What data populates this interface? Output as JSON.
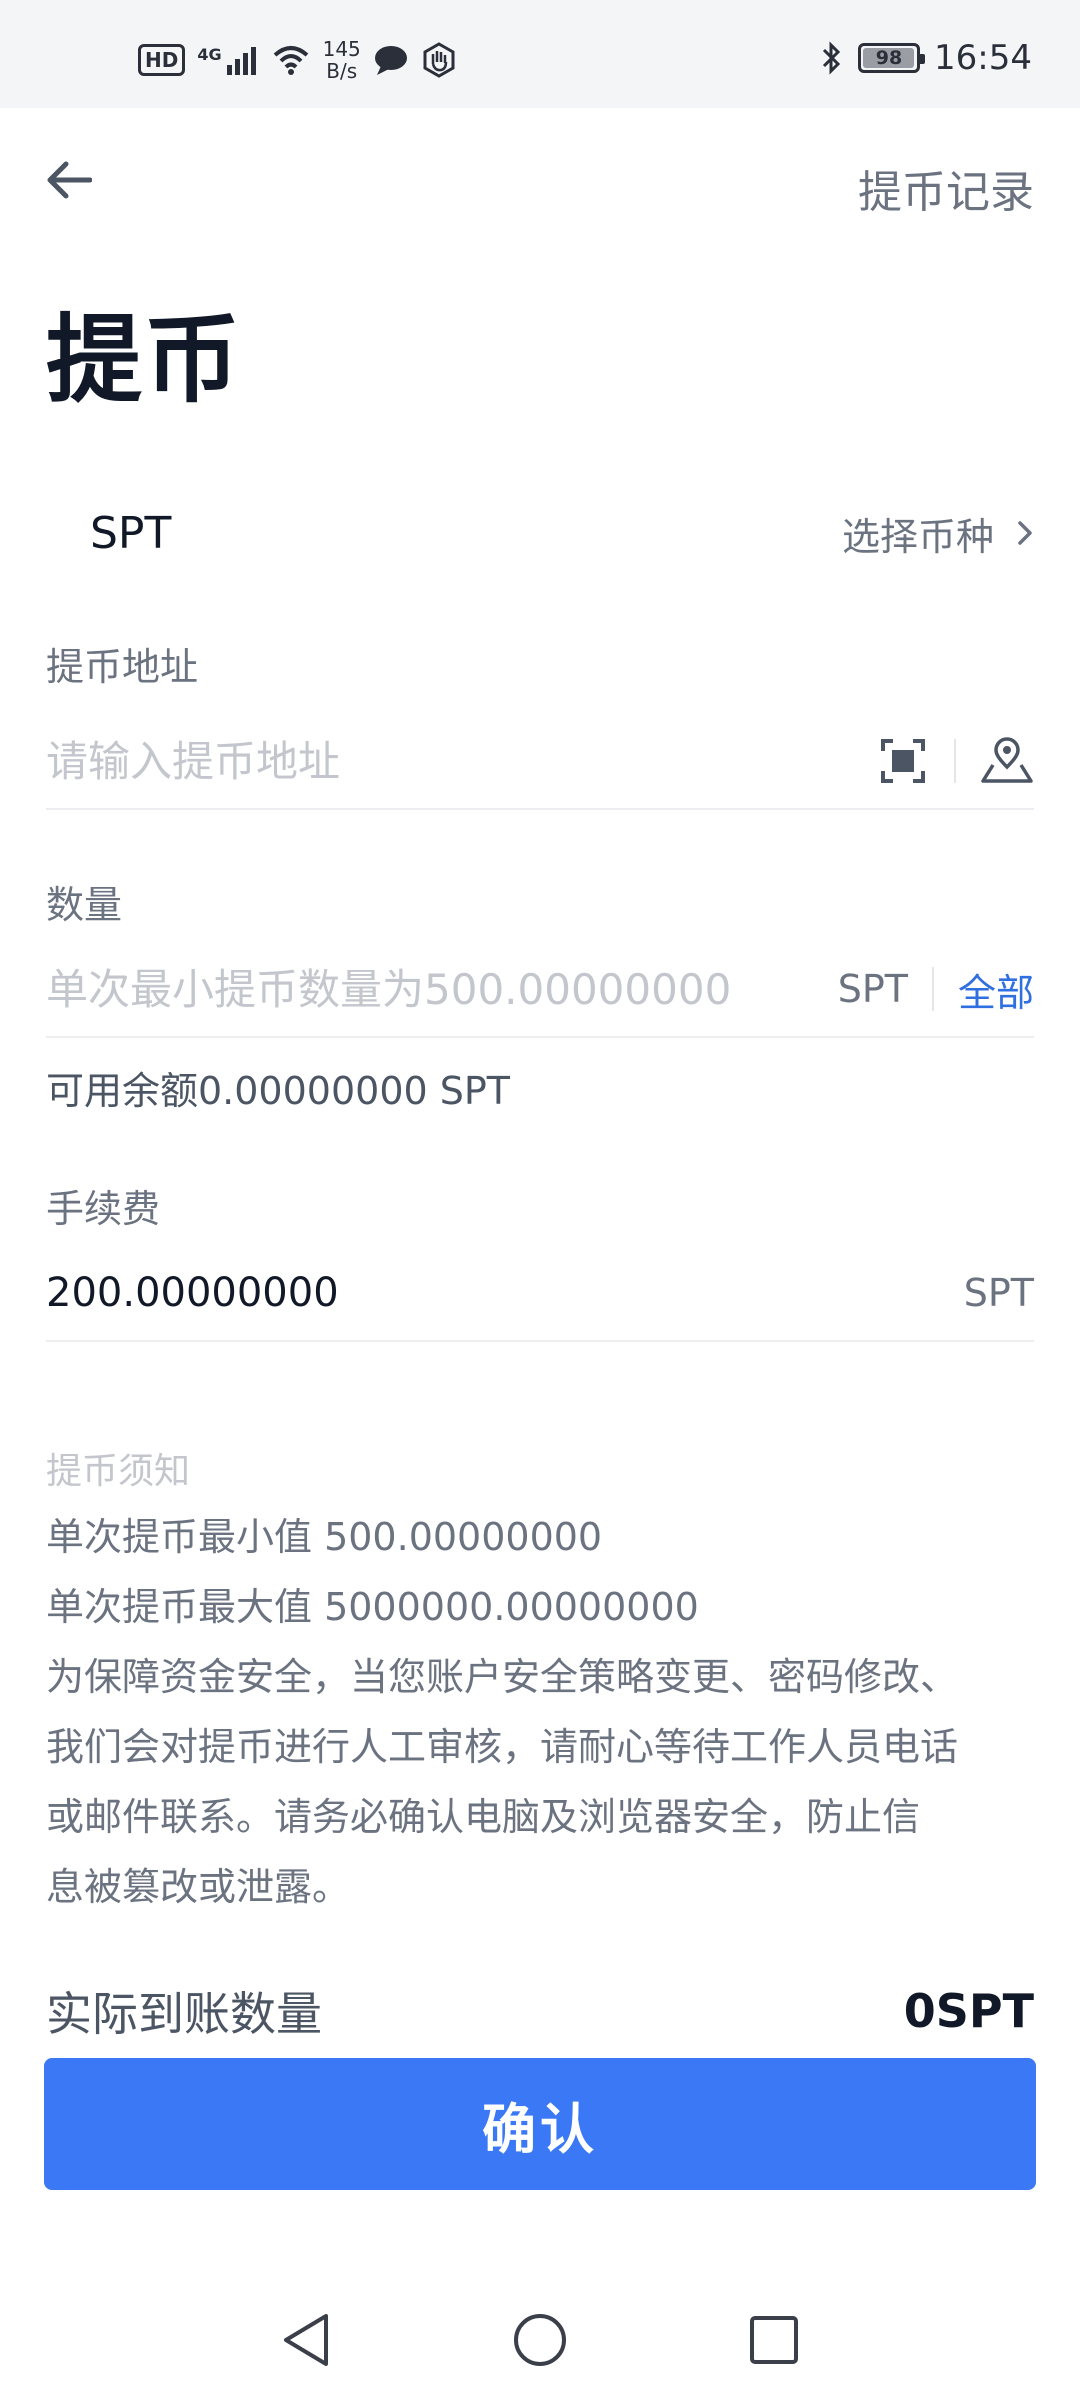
{
  "status_bar": {
    "hd_label": "HD",
    "network_label": "4G",
    "net_speed_value": "145",
    "net_speed_unit": "B/s",
    "battery_level": 98,
    "battery_label": "98",
    "time": "16:54"
  },
  "header": {
    "history_label": "提币记录",
    "title": "提币"
  },
  "coin": {
    "name": "SPT",
    "select_label": "选择币种"
  },
  "address": {
    "label": "提币地址",
    "placeholder": "请输入提币地址",
    "value": ""
  },
  "amount": {
    "label": "数量",
    "placeholder": "单次最小提币数量为500.00000000",
    "value": "",
    "unit": "SPT",
    "all_label": "全部",
    "balance_text": "可用余额0.00000000 SPT"
  },
  "fee": {
    "label": "手续费",
    "value": "200.00000000",
    "unit": "SPT"
  },
  "notes": {
    "title": "提币须知",
    "min_line": "单次提币最小值 500.00000000",
    "max_line": "单次提币最大值 5000000.00000000",
    "line1": "为保障资金安全，当您账户安全策略变更、密码修改、",
    "line2": "我们会对提币进行人工审核，请耐心等待工作人员电话",
    "line3": "或邮件联系。请务必确认电脑及浏览器安全，防止信",
    "line4": "息被篡改或泄露。"
  },
  "summary": {
    "received_label": "实际到账数量",
    "received_value": "0SPT"
  },
  "confirm_label": "确认",
  "colors": {
    "primary": "#3b78f5",
    "link": "#2f6fe0",
    "text": "#111827",
    "muted": "#6b7280"
  },
  "icons": {
    "back": "arrow-left-icon",
    "chevron": "chevron-right-icon",
    "scan": "scan-icon",
    "address_book": "location-book-icon"
  }
}
